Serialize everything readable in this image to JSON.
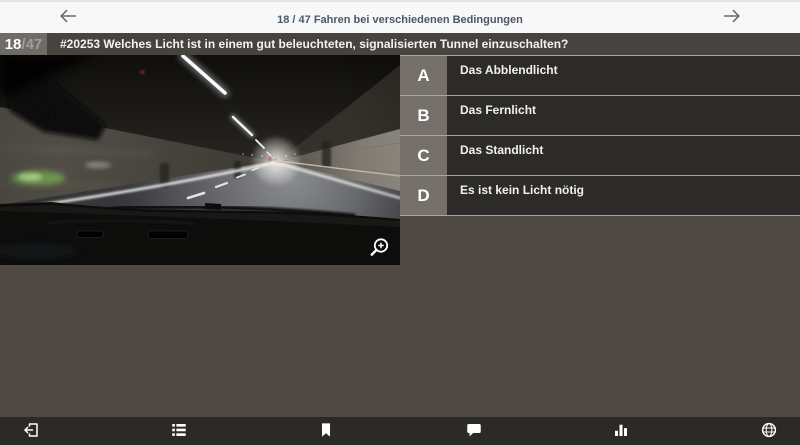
{
  "header": {
    "progress_label": "18 / 47 Fahren bei verschiedenen Bedingungen",
    "back_icon": "arrow-left-icon",
    "next_icon": "arrow-right-icon"
  },
  "question": {
    "current": "18",
    "separator": "/",
    "total": "47",
    "text": "#20253 Welches Licht ist in einem gut beleuchteten, signalisierten Tunnel einzuschalten?"
  },
  "media": {
    "description": "Fahrt durch einen beleuchteten, signalisierten Tunnel aus Fahrersicht",
    "zoom_icon": "magnifier-plus-icon"
  },
  "answers": [
    {
      "letter": "A",
      "text": "Das Abblendlicht"
    },
    {
      "letter": "B",
      "text": "Das Fernlicht"
    },
    {
      "letter": "C",
      "text": "Das Standlicht"
    },
    {
      "letter": "D",
      "text": "Es ist kein Licht nötig"
    }
  ],
  "footer": {
    "items": [
      {
        "name": "exit"
      },
      {
        "name": "question-list"
      },
      {
        "name": "bookmark"
      },
      {
        "name": "comments"
      },
      {
        "name": "statistics"
      },
      {
        "name": "language"
      }
    ]
  },
  "colors": {
    "accent_separator": "#c9a25e",
    "header_bg": "#f8f8f8",
    "header_text": "#4b5864",
    "question_bar_bg": "#474440",
    "question_badge_bg": "#6f6c68",
    "content_bg": "#4e4a43",
    "answer_row_bg": "#2d2b29",
    "answer_letter_bg": "#75706a",
    "footer_bg": "#2b2a27",
    "icon_color": "#ffffff"
  }
}
